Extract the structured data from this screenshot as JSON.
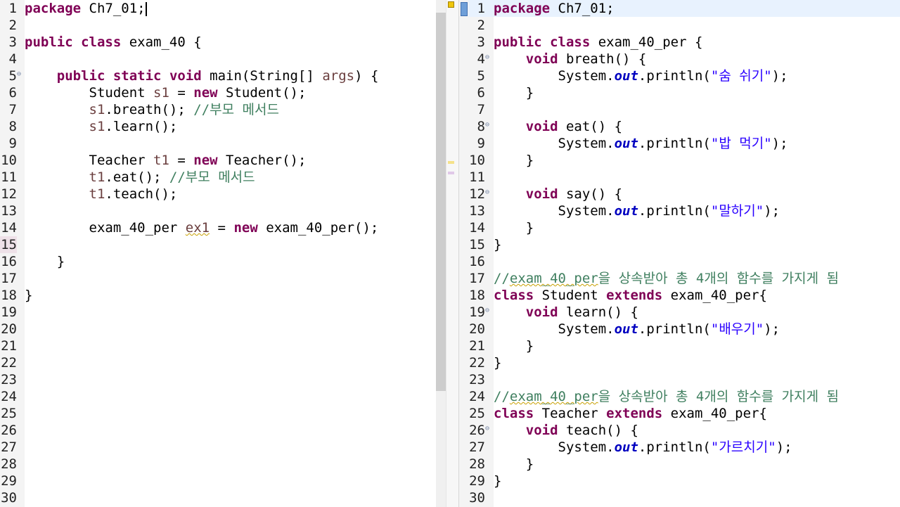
{
  "left_editor": {
    "lines": [
      {
        "n": "1",
        "tokens": [
          {
            "t": "package",
            "c": "k"
          },
          {
            "t": " Ch7_01;"
          }
        ],
        "cursor": true
      },
      {
        "n": "2",
        "tokens": []
      },
      {
        "n": "3",
        "tokens": [
          {
            "t": "public",
            "c": "k"
          },
          {
            "t": " "
          },
          {
            "t": "class",
            "c": "k"
          },
          {
            "t": " exam_40 {"
          }
        ]
      },
      {
        "n": "4",
        "tokens": []
      },
      {
        "n": "5",
        "fold": true,
        "tokens": [
          {
            "t": "    "
          },
          {
            "t": "public",
            "c": "k"
          },
          {
            "t": " "
          },
          {
            "t": "static",
            "c": "k"
          },
          {
            "t": " "
          },
          {
            "t": "void",
            "c": "k"
          },
          {
            "t": " main(String[] "
          },
          {
            "t": "args",
            "c": "v"
          },
          {
            "t": ") {"
          }
        ]
      },
      {
        "n": "6",
        "tokens": [
          {
            "t": "        Student "
          },
          {
            "t": "s1",
            "c": "v"
          },
          {
            "t": " = "
          },
          {
            "t": "new",
            "c": "k"
          },
          {
            "t": " Student();"
          }
        ]
      },
      {
        "n": "7",
        "tokens": [
          {
            "t": "        "
          },
          {
            "t": "s1",
            "c": "v"
          },
          {
            "t": ".breath(); "
          },
          {
            "t": "//부모 메서드",
            "c": "c"
          }
        ]
      },
      {
        "n": "8",
        "tokens": [
          {
            "t": "        "
          },
          {
            "t": "s1",
            "c": "v"
          },
          {
            "t": ".learn();"
          }
        ]
      },
      {
        "n": "9",
        "tokens": []
      },
      {
        "n": "10",
        "tokens": [
          {
            "t": "        Teacher "
          },
          {
            "t": "t1",
            "c": "v"
          },
          {
            "t": " = "
          },
          {
            "t": "new",
            "c": "k"
          },
          {
            "t": " Teacher();"
          }
        ]
      },
      {
        "n": "11",
        "tokens": [
          {
            "t": "        "
          },
          {
            "t": "t1",
            "c": "v"
          },
          {
            "t": ".eat(); "
          },
          {
            "t": "//부모 메서드",
            "c": "c"
          }
        ]
      },
      {
        "n": "12",
        "tokens": [
          {
            "t": "        "
          },
          {
            "t": "t1",
            "c": "v"
          },
          {
            "t": ".teach();"
          }
        ]
      },
      {
        "n": "13",
        "tokens": []
      },
      {
        "n": "14",
        "tokens": [
          {
            "t": "        exam_40_per "
          },
          {
            "t": "ex1",
            "c": "v w"
          },
          {
            "t": " = "
          },
          {
            "t": "new",
            "c": "k"
          },
          {
            "t": " exam_40_per();"
          }
        ]
      },
      {
        "n": "15",
        "tokens": [],
        "bp": true
      },
      {
        "n": "16",
        "tokens": [
          {
            "t": "    }"
          }
        ]
      },
      {
        "n": "17",
        "tokens": []
      },
      {
        "n": "18",
        "tokens": [
          {
            "t": "}"
          }
        ]
      },
      {
        "n": "19",
        "tokens": []
      },
      {
        "n": "20",
        "tokens": []
      },
      {
        "n": "21",
        "tokens": []
      },
      {
        "n": "22",
        "tokens": []
      },
      {
        "n": "23",
        "tokens": []
      },
      {
        "n": "24",
        "tokens": []
      },
      {
        "n": "25",
        "tokens": []
      },
      {
        "n": "26",
        "tokens": []
      },
      {
        "n": "27",
        "tokens": []
      },
      {
        "n": "28",
        "tokens": []
      },
      {
        "n": "29",
        "tokens": []
      },
      {
        "n": "30",
        "tokens": []
      }
    ]
  },
  "right_editor": {
    "lines": [
      {
        "n": "1",
        "current": true,
        "tokens": [
          {
            "t": "package",
            "c": "k"
          },
          {
            "t": " Ch7_01;"
          }
        ]
      },
      {
        "n": "2",
        "tokens": []
      },
      {
        "n": "3",
        "tokens": [
          {
            "t": "public",
            "c": "k"
          },
          {
            "t": " "
          },
          {
            "t": "class",
            "c": "k"
          },
          {
            "t": " exam_40_per {"
          }
        ]
      },
      {
        "n": "4",
        "fold": true,
        "tokens": [
          {
            "t": "    "
          },
          {
            "t": "void",
            "c": "k"
          },
          {
            "t": " breath() {"
          }
        ]
      },
      {
        "n": "5",
        "tokens": [
          {
            "t": "        System."
          },
          {
            "t": "out",
            "c": "f"
          },
          {
            "t": ".println("
          },
          {
            "t": "\"숨 쉬기\"",
            "c": "s"
          },
          {
            "t": ");"
          }
        ]
      },
      {
        "n": "6",
        "tokens": [
          {
            "t": "    }"
          }
        ]
      },
      {
        "n": "7",
        "tokens": []
      },
      {
        "n": "8",
        "fold": true,
        "tokens": [
          {
            "t": "    "
          },
          {
            "t": "void",
            "c": "k"
          },
          {
            "t": " eat() {"
          }
        ]
      },
      {
        "n": "9",
        "tokens": [
          {
            "t": "        System."
          },
          {
            "t": "out",
            "c": "f"
          },
          {
            "t": ".println("
          },
          {
            "t": "\"밥 먹기\"",
            "c": "s"
          },
          {
            "t": ");"
          }
        ]
      },
      {
        "n": "10",
        "tokens": [
          {
            "t": "    }"
          }
        ]
      },
      {
        "n": "11",
        "tokens": []
      },
      {
        "n": "12",
        "fold": true,
        "tokens": [
          {
            "t": "    "
          },
          {
            "t": "void",
            "c": "k"
          },
          {
            "t": " say() {"
          }
        ]
      },
      {
        "n": "13",
        "tokens": [
          {
            "t": "        System."
          },
          {
            "t": "out",
            "c": "f"
          },
          {
            "t": ".println("
          },
          {
            "t": "\"말하기\"",
            "c": "s"
          },
          {
            "t": ");"
          }
        ]
      },
      {
        "n": "14",
        "tokens": [
          {
            "t": "    }"
          }
        ]
      },
      {
        "n": "15",
        "tokens": [
          {
            "t": "}"
          }
        ]
      },
      {
        "n": "16",
        "tokens": []
      },
      {
        "n": "17",
        "tokens": [
          {
            "t": "//",
            "c": "c"
          },
          {
            "t": "exam_40_per",
            "c": "c w"
          },
          {
            "t": "을 상속받아 총 4개의 함수를 가지게 됨",
            "c": "c"
          }
        ]
      },
      {
        "n": "18",
        "tokens": [
          {
            "t": "class",
            "c": "k"
          },
          {
            "t": " Student "
          },
          {
            "t": "extends",
            "c": "k"
          },
          {
            "t": " exam_40_per{"
          }
        ]
      },
      {
        "n": "19",
        "fold": true,
        "tokens": [
          {
            "t": "    "
          },
          {
            "t": "void",
            "c": "k"
          },
          {
            "t": " learn() {"
          }
        ]
      },
      {
        "n": "20",
        "tokens": [
          {
            "t": "        System."
          },
          {
            "t": "out",
            "c": "f"
          },
          {
            "t": ".println("
          },
          {
            "t": "\"배우기\"",
            "c": "s"
          },
          {
            "t": ");"
          }
        ]
      },
      {
        "n": "21",
        "tokens": [
          {
            "t": "    }"
          }
        ]
      },
      {
        "n": "22",
        "tokens": [
          {
            "t": "}"
          }
        ]
      },
      {
        "n": "23",
        "tokens": []
      },
      {
        "n": "24",
        "tokens": [
          {
            "t": "//",
            "c": "c"
          },
          {
            "t": "exam_40_per",
            "c": "c w"
          },
          {
            "t": "을 상속받아 총 4개의 함수를 가지게 됨",
            "c": "c"
          }
        ]
      },
      {
        "n": "25",
        "tokens": [
          {
            "t": "class",
            "c": "k"
          },
          {
            "t": " Teacher "
          },
          {
            "t": "extends",
            "c": "k"
          },
          {
            "t": " exam_40_per{"
          }
        ]
      },
      {
        "n": "26",
        "fold": true,
        "tokens": [
          {
            "t": "    "
          },
          {
            "t": "void",
            "c": "k"
          },
          {
            "t": " teach() {"
          }
        ]
      },
      {
        "n": "27",
        "tokens": [
          {
            "t": "        System."
          },
          {
            "t": "out",
            "c": "f"
          },
          {
            "t": ".println("
          },
          {
            "t": "\"가르치기\"",
            "c": "s"
          },
          {
            "t": ");"
          }
        ]
      },
      {
        "n": "28",
        "tokens": [
          {
            "t": "    }"
          }
        ]
      },
      {
        "n": "29",
        "tokens": [
          {
            "t": "}"
          }
        ]
      },
      {
        "n": "30",
        "tokens": []
      }
    ]
  },
  "icons": {
    "fold": "collapse-fold-icon",
    "warning": "warning-marker-icon"
  }
}
